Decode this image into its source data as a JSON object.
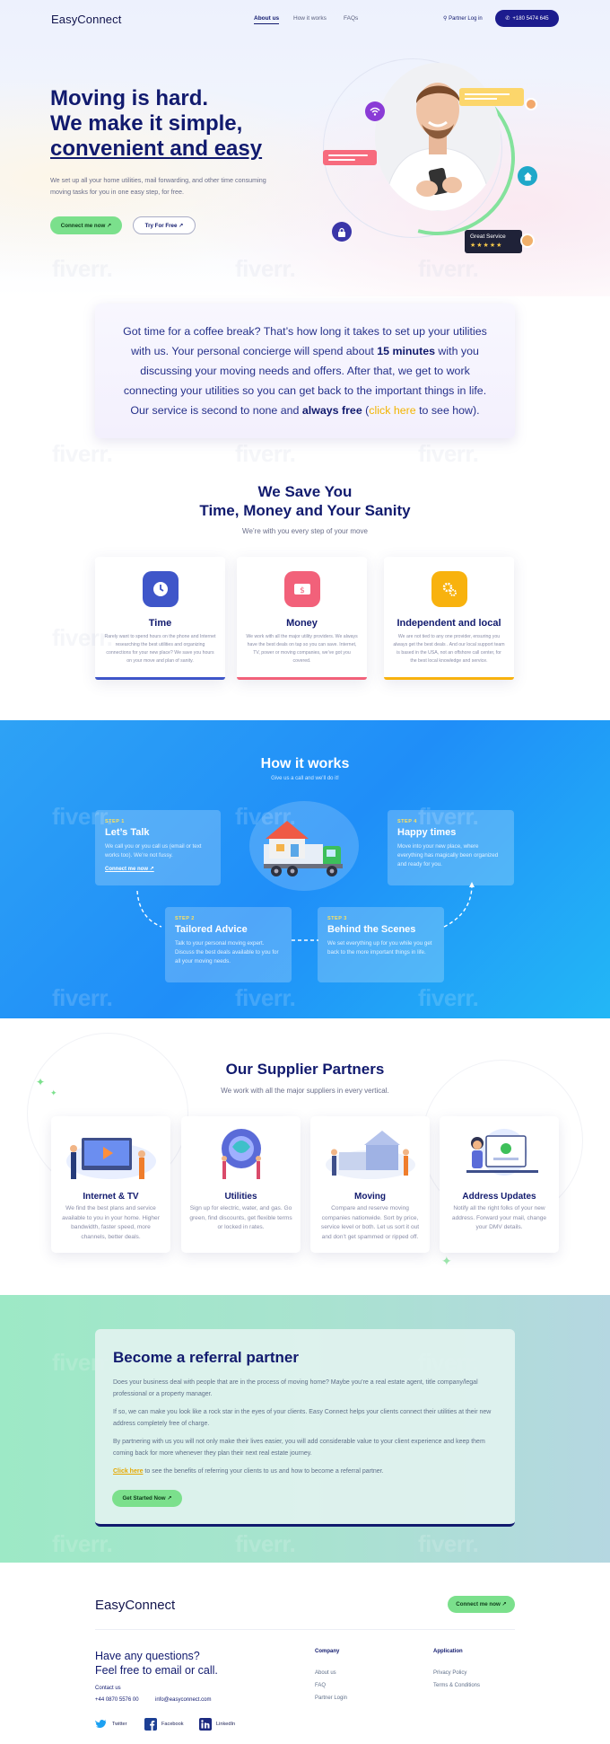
{
  "nav": {
    "logo": "EasyConnect",
    "links": [
      "About us",
      "How it works",
      "FAQs"
    ],
    "partner_login": "Partner Log in",
    "phone": "+180 5474 645"
  },
  "hero": {
    "headline_1": "Moving is hard.",
    "headline_2": "We make it simple,",
    "headline_3": "convenient and easy",
    "subtext": "We set up all your home utilities, mail forwarding, and other time consuming moving tasks for you in one easy step, for free.",
    "primary_cta": "Connect me now ↗",
    "secondary_cta": "Try For Free ↗",
    "badge": "Great Service",
    "stars": "★★★★★"
  },
  "intro": {
    "p1": "Got time for a coffee break? That’s how long it takes to set up your utilities with us. Your personal concierge will spend about ",
    "p1_bold": "15 minutes",
    "p2": " with you discussing your moving needs and offers. After that, we get to work connecting your utilities so you can get back to the important things in life. Our service is second to none and ",
    "p2_bold": "always free",
    "p3": " (",
    "link": "click here",
    "p4": " to see how)."
  },
  "save": {
    "title_1": "We Save You",
    "title_2": "Time, Money and Your Sanity",
    "subtitle": "We’re with you every step of your move",
    "cards": [
      {
        "title": "Time",
        "icon": "clock-icon",
        "color": "#3f56c9",
        "bar": "#3f56c9",
        "text": "Rarely want to spend hours on the phone and Internet researching the best utilities and organizing connections for your new place? We save you hours on your move and plan of sanity."
      },
      {
        "title": "Money",
        "icon": "money-icon",
        "color": "#f2617a",
        "bar": "#f2617a",
        "text": "We work with all the major utility providers. We always have the best deals on tap so you can save. Internet, TV, power or moving companies, we’ve got you covered."
      },
      {
        "title": "Independent and local",
        "icon": "gears-icon",
        "color": "#f8b20e",
        "bar": "#f8b20e",
        "text": "We are not tied to any one provider, ensuring you always get the best deals . And our local support team is based in the USA, not an offshore call center, for the best local knowledge and service."
      }
    ]
  },
  "how": {
    "title": "How it works",
    "subtitle": "Give us a call and we’ll do it!",
    "steps": [
      {
        "num": "STEP 1",
        "title": "Let’s Talk",
        "text": "We call you or you call us (email or text works too). We’re not fussy.",
        "cta": "Connect me now ↗"
      },
      {
        "num": "STEP 2",
        "title": "Tailored Advice",
        "text": "Talk to your personal moving expert. Discuss the best deals available to you for all your moving needs."
      },
      {
        "num": "STEP 3",
        "title": "Behind the Scenes",
        "text": "We set everything up for you while you get back to the more important things in life."
      },
      {
        "num": "STEP 4",
        "title": "Happy times",
        "text": "Move into your new place, where everything has magically been organized and ready for you."
      }
    ]
  },
  "partners": {
    "title": "Our Supplier Partners",
    "subtitle": "We work with all the major suppliers in every vertical.",
    "cards": [
      {
        "title": "Internet & TV",
        "text": "We find the best plans and service available to you in your home. Higher bandwidth, faster speed, more channels, better deals."
      },
      {
        "title": "Utilities",
        "text": "Sign up for electric, water, and gas. Go green, find discounts, get flexible terms or locked in rates."
      },
      {
        "title": "Moving",
        "text": "Compare and reserve moving companies nationwide. Sort by price, service level or both. Let us sort it out and don’t get spammed or ripped off."
      },
      {
        "title": "Address Updates",
        "text": "Notify all the right folks of your new address. Forward your mail, change your DMV details."
      }
    ]
  },
  "referral": {
    "title": "Become a referral partner",
    "p1": "Does your business deal with people that are in the process of moving home? Maybe you’re a real estate agent, title company/legal professional or a property manager.",
    "p2": "If so, we can make you look like a rock star in the eyes of your clients. Easy Connect helps your clients connect their utilities at their new address completely   free of charge.",
    "p3": "By partnering with us you will not only make their lives easier, you will add considerable value to your client experience and keep them coming back for more whenever they   plan their next real estate journey.",
    "link": "Click here",
    "p4": " to see the benefits of referring your clients to us and how to become  a referral partner.",
    "cta": "Get Started Now ↗"
  },
  "footer": {
    "logo": "EasyConnect",
    "cta": "Connect me now ↗",
    "question_1": "Have any questions?",
    "question_2": "Feel free to email or call.",
    "contact_label": "Contact us",
    "phone": "+44 0870 5576 00",
    "email": "info@easyconnect.com",
    "company_heading": "Company",
    "company_links": [
      "About us",
      "FAQ",
      "Partner Login"
    ],
    "application_heading": "Application",
    "application_links": [
      "Privacy Policy",
      "Terms & Conditions"
    ],
    "social": [
      "Twitter",
      "Facebook",
      "LinkedIn"
    ]
  },
  "watermark": "fiverr."
}
